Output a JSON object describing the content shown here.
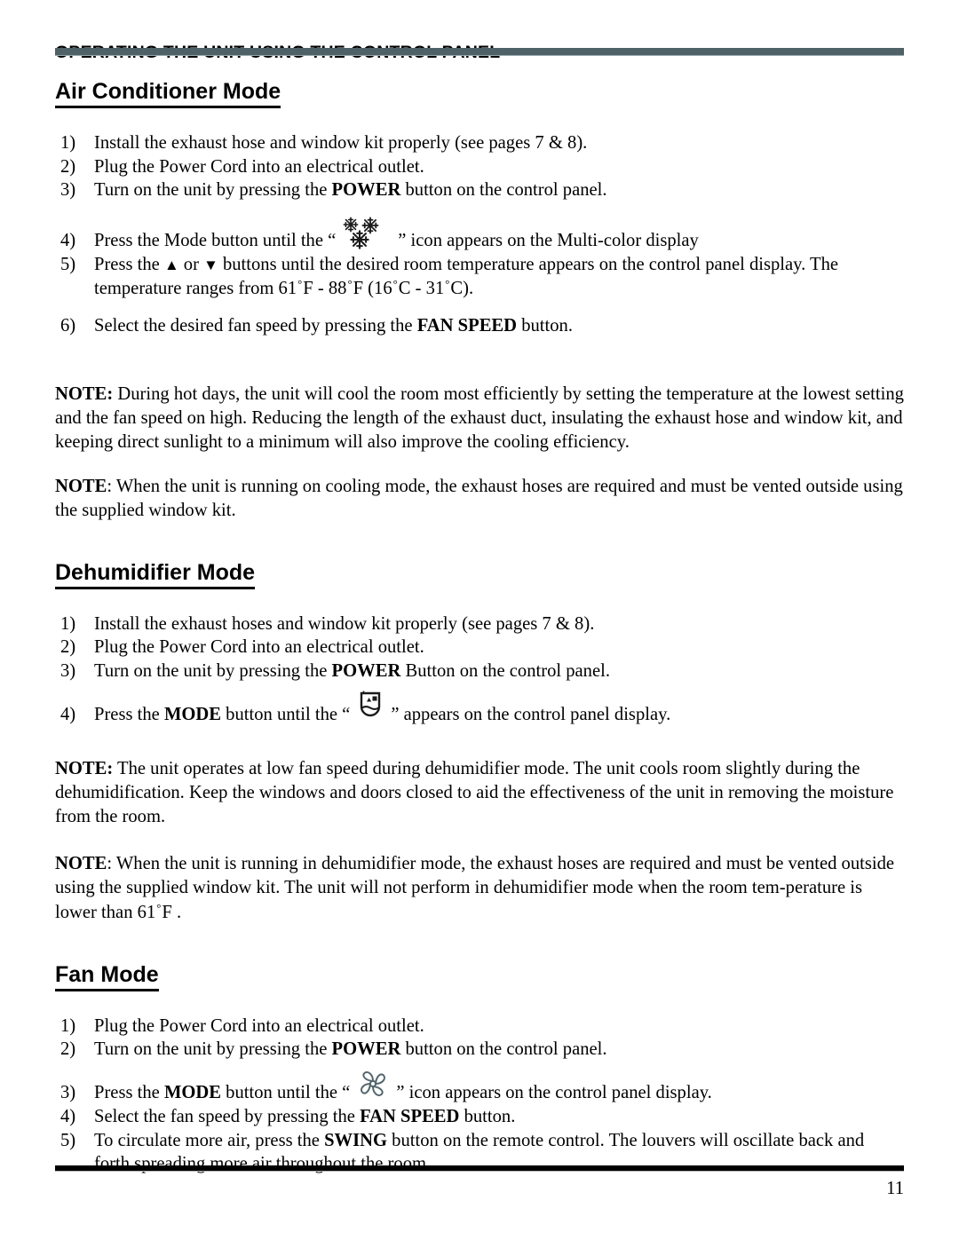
{
  "document": {
    "kicker": "OPERATING THE UNIT USING THE CONTROL PANEL",
    "page_number": "11",
    "rule_color": "#4e6166",
    "footer_rule_color": "#000000"
  },
  "sections": [
    {
      "heading": "Air Conditioner Mode",
      "steps": [
        {
          "num": "1)",
          "text": "Install the exhaust hose and window kit properly (see pages 7 & 8)."
        },
        {
          "num": "2)",
          "text": "Plug the Power Cord into an electrical outlet."
        },
        {
          "num": "3)",
          "pre": "Turn on the unit by pressing the ",
          "bold": "POWER",
          "post": " button on the control panel."
        },
        {
          "num": "4)",
          "pre": "Press the Mode button until the “",
          "icon": "snowflake-icon",
          "post": "” icon appears on the Multi-color display"
        },
        {
          "num": "5)",
          "pre": "Press the ",
          "tri_up": "▲",
          "mid": " or ",
          "tri_down": "▼",
          "post": " buttons until the desired room temperature appears on the control panel display.  The temperature ranges from 61",
          "deg1": "°",
          "t1": "F - 88",
          "deg2": "°",
          "t2": "F (16",
          "deg3": "°",
          "t3": "C - 31",
          "deg4": "°",
          "t4": "C)."
        },
        {
          "num": "6)",
          "pre": "Select the desired fan speed by pressing the ",
          "bold": "FAN SPEED",
          "post": " button."
        }
      ],
      "notes": [
        {
          "label": "NOTE:",
          "text": " During hot days, the unit will cool the room most efficiently by setting the temperature at the lowest setting and the fan speed on high. Reducing the length of the exhaust duct, insulating the exhaust hose and window kit, and keeping direct sunlight to a minimum will also improve the cooling efficiency."
        },
        {
          "label": "NOTE",
          "text": ": When the unit is running on cooling mode, the exhaust hoses are required and must be vented outside using the supplied window kit."
        }
      ]
    },
    {
      "heading": "Dehumidifier Mode",
      "steps": [
        {
          "num": "1)",
          "text": "Install the exhaust hoses and window kit properly (see pages 7 & 8)."
        },
        {
          "num": "2)",
          "text": "Plug the Power Cord into an electrical outlet."
        },
        {
          "num": "3)",
          "pre": "Turn on the unit by pressing the ",
          "bold": "POWER",
          "post": " Button on the control panel."
        },
        {
          "num": "4)",
          "pre": "Press the ",
          "bold": "MODE",
          "mid": " button until the “",
          "icon": "dehumidifier-bucket-icon",
          "post": "” appears on the control panel display."
        }
      ],
      "notes": [
        {
          "label": "NOTE:",
          "text": "  The unit operates at low fan speed during dehumidifier mode.  The unit cools room slightly during the dehumidification. Keep the windows and doors closed to aid the effectiveness of the unit in removing the moisture from the room."
        },
        {
          "label": "NOTE",
          "text": ": When the unit is running in dehumidifier mode, the exhaust hoses are required and must be vented outside using the supplied window kit.  The unit will not perform in dehumidifier mode when the room tem-perature is lower than 61",
          "deg": "°",
          "tail": "F ."
        }
      ]
    },
    {
      "heading": "Fan Mode",
      "steps": [
        {
          "num": "1)",
          "text": "Plug the Power Cord into an electrical outlet."
        },
        {
          "num": "2)",
          "pre": "Turn on the unit by pressing the ",
          "bold": "POWER",
          "post": " button on the control panel."
        },
        {
          "num": "3)",
          "pre": "Press the ",
          "bold": "MODE",
          "mid": " button until the “",
          "icon": "fan-blade-icon",
          "post": "” icon appears on the control panel display."
        },
        {
          "num": "4)",
          "pre": "Select the fan speed by pressing the ",
          "bold": "FAN SPEED",
          "post": " button."
        },
        {
          "num": "5)",
          "pre": "To circulate more air, press the ",
          "bold": "SWING",
          "post": " button on the remote control. The louvers will oscillate back and forth spreading more air throughout the room."
        }
      ],
      "notes": []
    }
  ]
}
